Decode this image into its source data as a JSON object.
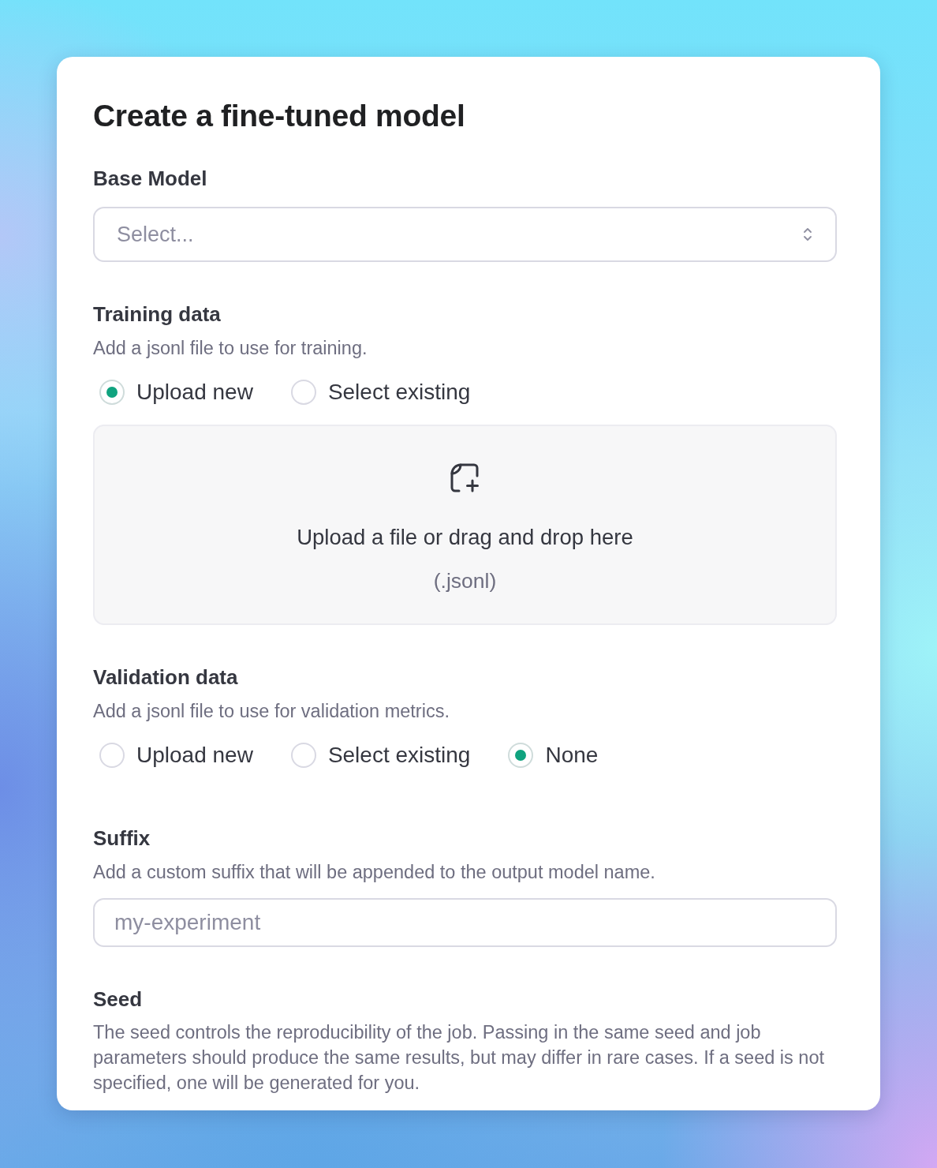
{
  "title": "Create a fine-tuned model",
  "sections": [
    {
      "kind": "select",
      "label": "Base Model",
      "placeholder": "Select..."
    },
    {
      "kind": "choice",
      "label": "Training data",
      "description": "Add a jsonl file to use for training.",
      "options": [
        {
          "label": "Upload new",
          "selected": true
        },
        {
          "label": "Select existing",
          "selected": false
        }
      ],
      "dropzone": {
        "prompt": "Upload a file or drag and drop here",
        "hint": "(.jsonl)"
      }
    },
    {
      "kind": "choice",
      "label": "Validation data",
      "description": "Add a jsonl file to use for validation metrics.",
      "options": [
        {
          "label": "Upload new",
          "selected": false
        },
        {
          "label": "Select existing",
          "selected": false
        },
        {
          "label": "None",
          "selected": true
        }
      ]
    },
    {
      "kind": "input",
      "label": "Suffix",
      "description": "Add a custom suffix that will be appended to the output model name.",
      "placeholder": "my-experiment"
    },
    {
      "kind": "info",
      "label": "Seed",
      "description": "The seed controls the reproducibility of the job. Passing in the same seed and job parameters should produce the same results, but may differ in rare cases. If a seed is not specified, one will be generated for you."
    }
  ]
}
